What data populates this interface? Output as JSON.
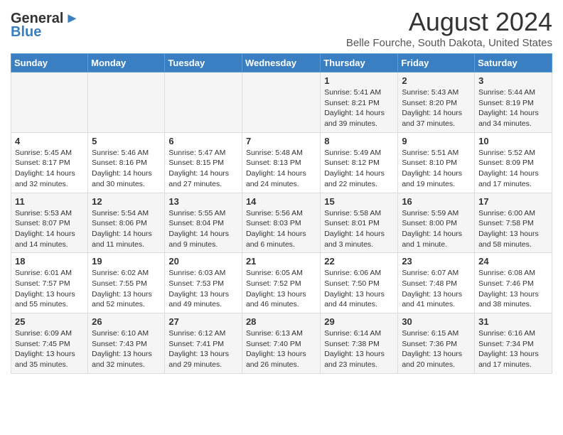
{
  "header": {
    "logo_general": "General",
    "logo_blue": "Blue",
    "month_year": "August 2024",
    "location": "Belle Fourche, South Dakota, United States"
  },
  "weekdays": [
    "Sunday",
    "Monday",
    "Tuesday",
    "Wednesday",
    "Thursday",
    "Friday",
    "Saturday"
  ],
  "weeks": [
    [
      {
        "day": "",
        "info": ""
      },
      {
        "day": "",
        "info": ""
      },
      {
        "day": "",
        "info": ""
      },
      {
        "day": "",
        "info": ""
      },
      {
        "day": "1",
        "info": "Sunrise: 5:41 AM\nSunset: 8:21 PM\nDaylight: 14 hours\nand 39 minutes."
      },
      {
        "day": "2",
        "info": "Sunrise: 5:43 AM\nSunset: 8:20 PM\nDaylight: 14 hours\nand 37 minutes."
      },
      {
        "day": "3",
        "info": "Sunrise: 5:44 AM\nSunset: 8:19 PM\nDaylight: 14 hours\nand 34 minutes."
      }
    ],
    [
      {
        "day": "4",
        "info": "Sunrise: 5:45 AM\nSunset: 8:17 PM\nDaylight: 14 hours\nand 32 minutes."
      },
      {
        "day": "5",
        "info": "Sunrise: 5:46 AM\nSunset: 8:16 PM\nDaylight: 14 hours\nand 30 minutes."
      },
      {
        "day": "6",
        "info": "Sunrise: 5:47 AM\nSunset: 8:15 PM\nDaylight: 14 hours\nand 27 minutes."
      },
      {
        "day": "7",
        "info": "Sunrise: 5:48 AM\nSunset: 8:13 PM\nDaylight: 14 hours\nand 24 minutes."
      },
      {
        "day": "8",
        "info": "Sunrise: 5:49 AM\nSunset: 8:12 PM\nDaylight: 14 hours\nand 22 minutes."
      },
      {
        "day": "9",
        "info": "Sunrise: 5:51 AM\nSunset: 8:10 PM\nDaylight: 14 hours\nand 19 minutes."
      },
      {
        "day": "10",
        "info": "Sunrise: 5:52 AM\nSunset: 8:09 PM\nDaylight: 14 hours\nand 17 minutes."
      }
    ],
    [
      {
        "day": "11",
        "info": "Sunrise: 5:53 AM\nSunset: 8:07 PM\nDaylight: 14 hours\nand 14 minutes."
      },
      {
        "day": "12",
        "info": "Sunrise: 5:54 AM\nSunset: 8:06 PM\nDaylight: 14 hours\nand 11 minutes."
      },
      {
        "day": "13",
        "info": "Sunrise: 5:55 AM\nSunset: 8:04 PM\nDaylight: 14 hours\nand 9 minutes."
      },
      {
        "day": "14",
        "info": "Sunrise: 5:56 AM\nSunset: 8:03 PM\nDaylight: 14 hours\nand 6 minutes."
      },
      {
        "day": "15",
        "info": "Sunrise: 5:58 AM\nSunset: 8:01 PM\nDaylight: 14 hours\nand 3 minutes."
      },
      {
        "day": "16",
        "info": "Sunrise: 5:59 AM\nSunset: 8:00 PM\nDaylight: 14 hours\nand 1 minute."
      },
      {
        "day": "17",
        "info": "Sunrise: 6:00 AM\nSunset: 7:58 PM\nDaylight: 13 hours\nand 58 minutes."
      }
    ],
    [
      {
        "day": "18",
        "info": "Sunrise: 6:01 AM\nSunset: 7:57 PM\nDaylight: 13 hours\nand 55 minutes."
      },
      {
        "day": "19",
        "info": "Sunrise: 6:02 AM\nSunset: 7:55 PM\nDaylight: 13 hours\nand 52 minutes."
      },
      {
        "day": "20",
        "info": "Sunrise: 6:03 AM\nSunset: 7:53 PM\nDaylight: 13 hours\nand 49 minutes."
      },
      {
        "day": "21",
        "info": "Sunrise: 6:05 AM\nSunset: 7:52 PM\nDaylight: 13 hours\nand 46 minutes."
      },
      {
        "day": "22",
        "info": "Sunrise: 6:06 AM\nSunset: 7:50 PM\nDaylight: 13 hours\nand 44 minutes."
      },
      {
        "day": "23",
        "info": "Sunrise: 6:07 AM\nSunset: 7:48 PM\nDaylight: 13 hours\nand 41 minutes."
      },
      {
        "day": "24",
        "info": "Sunrise: 6:08 AM\nSunset: 7:46 PM\nDaylight: 13 hours\nand 38 minutes."
      }
    ],
    [
      {
        "day": "25",
        "info": "Sunrise: 6:09 AM\nSunset: 7:45 PM\nDaylight: 13 hours\nand 35 minutes."
      },
      {
        "day": "26",
        "info": "Sunrise: 6:10 AM\nSunset: 7:43 PM\nDaylight: 13 hours\nand 32 minutes."
      },
      {
        "day": "27",
        "info": "Sunrise: 6:12 AM\nSunset: 7:41 PM\nDaylight: 13 hours\nand 29 minutes."
      },
      {
        "day": "28",
        "info": "Sunrise: 6:13 AM\nSunset: 7:40 PM\nDaylight: 13 hours\nand 26 minutes."
      },
      {
        "day": "29",
        "info": "Sunrise: 6:14 AM\nSunset: 7:38 PM\nDaylight: 13 hours\nand 23 minutes."
      },
      {
        "day": "30",
        "info": "Sunrise: 6:15 AM\nSunset: 7:36 PM\nDaylight: 13 hours\nand 20 minutes."
      },
      {
        "day": "31",
        "info": "Sunrise: 6:16 AM\nSunset: 7:34 PM\nDaylight: 13 hours\nand 17 minutes."
      }
    ]
  ]
}
